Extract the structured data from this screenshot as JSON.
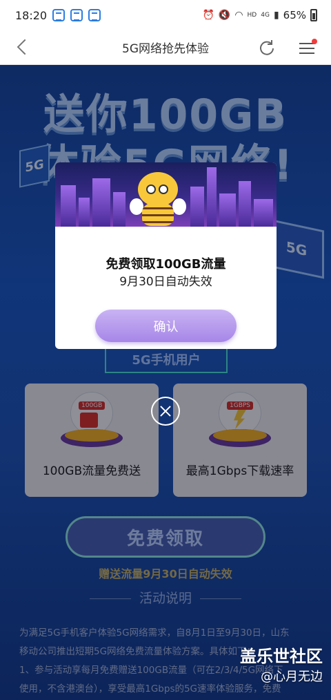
{
  "status_bar": {
    "time": "18:20",
    "network": "4G",
    "hd": "HD",
    "battery": "65%"
  },
  "nav": {
    "title": "5G网络抢先体验"
  },
  "hero": {
    "line1": "送你100GB",
    "line2": "体验5G网络!",
    "tag_5g": "5G",
    "laptop_label": "5G",
    "user_tag": "5G手机用户"
  },
  "cards": [
    {
      "badge": "100GB",
      "label": "100GB流量免费送"
    },
    {
      "badge": "1GBPS",
      "label": "最高1Gbps下载速率"
    }
  ],
  "claim_button": "免费领取",
  "expire_note": "赠送流量9月30日自动失效",
  "section_title": "活动说明",
  "description": [
    "为满足5G手机客户体验5G网络需求，自8月1日至9月30日，山东",
    "移动公司推出短期5G网络免费流量体验方案。具体如下：",
    "1、参与活动享每月免费赠送100GB流量（可在2/3/4/5G网络下",
    "使用，不含港澳台），享受最高1Gbps的5G速率体验服务，免费"
  ],
  "modal": {
    "title": "免费领取100GB流量",
    "subtitle": "9月30日自动失效",
    "confirm": "确认"
  },
  "watermark": {
    "title": "盖乐世社区",
    "user": "@心月无边"
  }
}
